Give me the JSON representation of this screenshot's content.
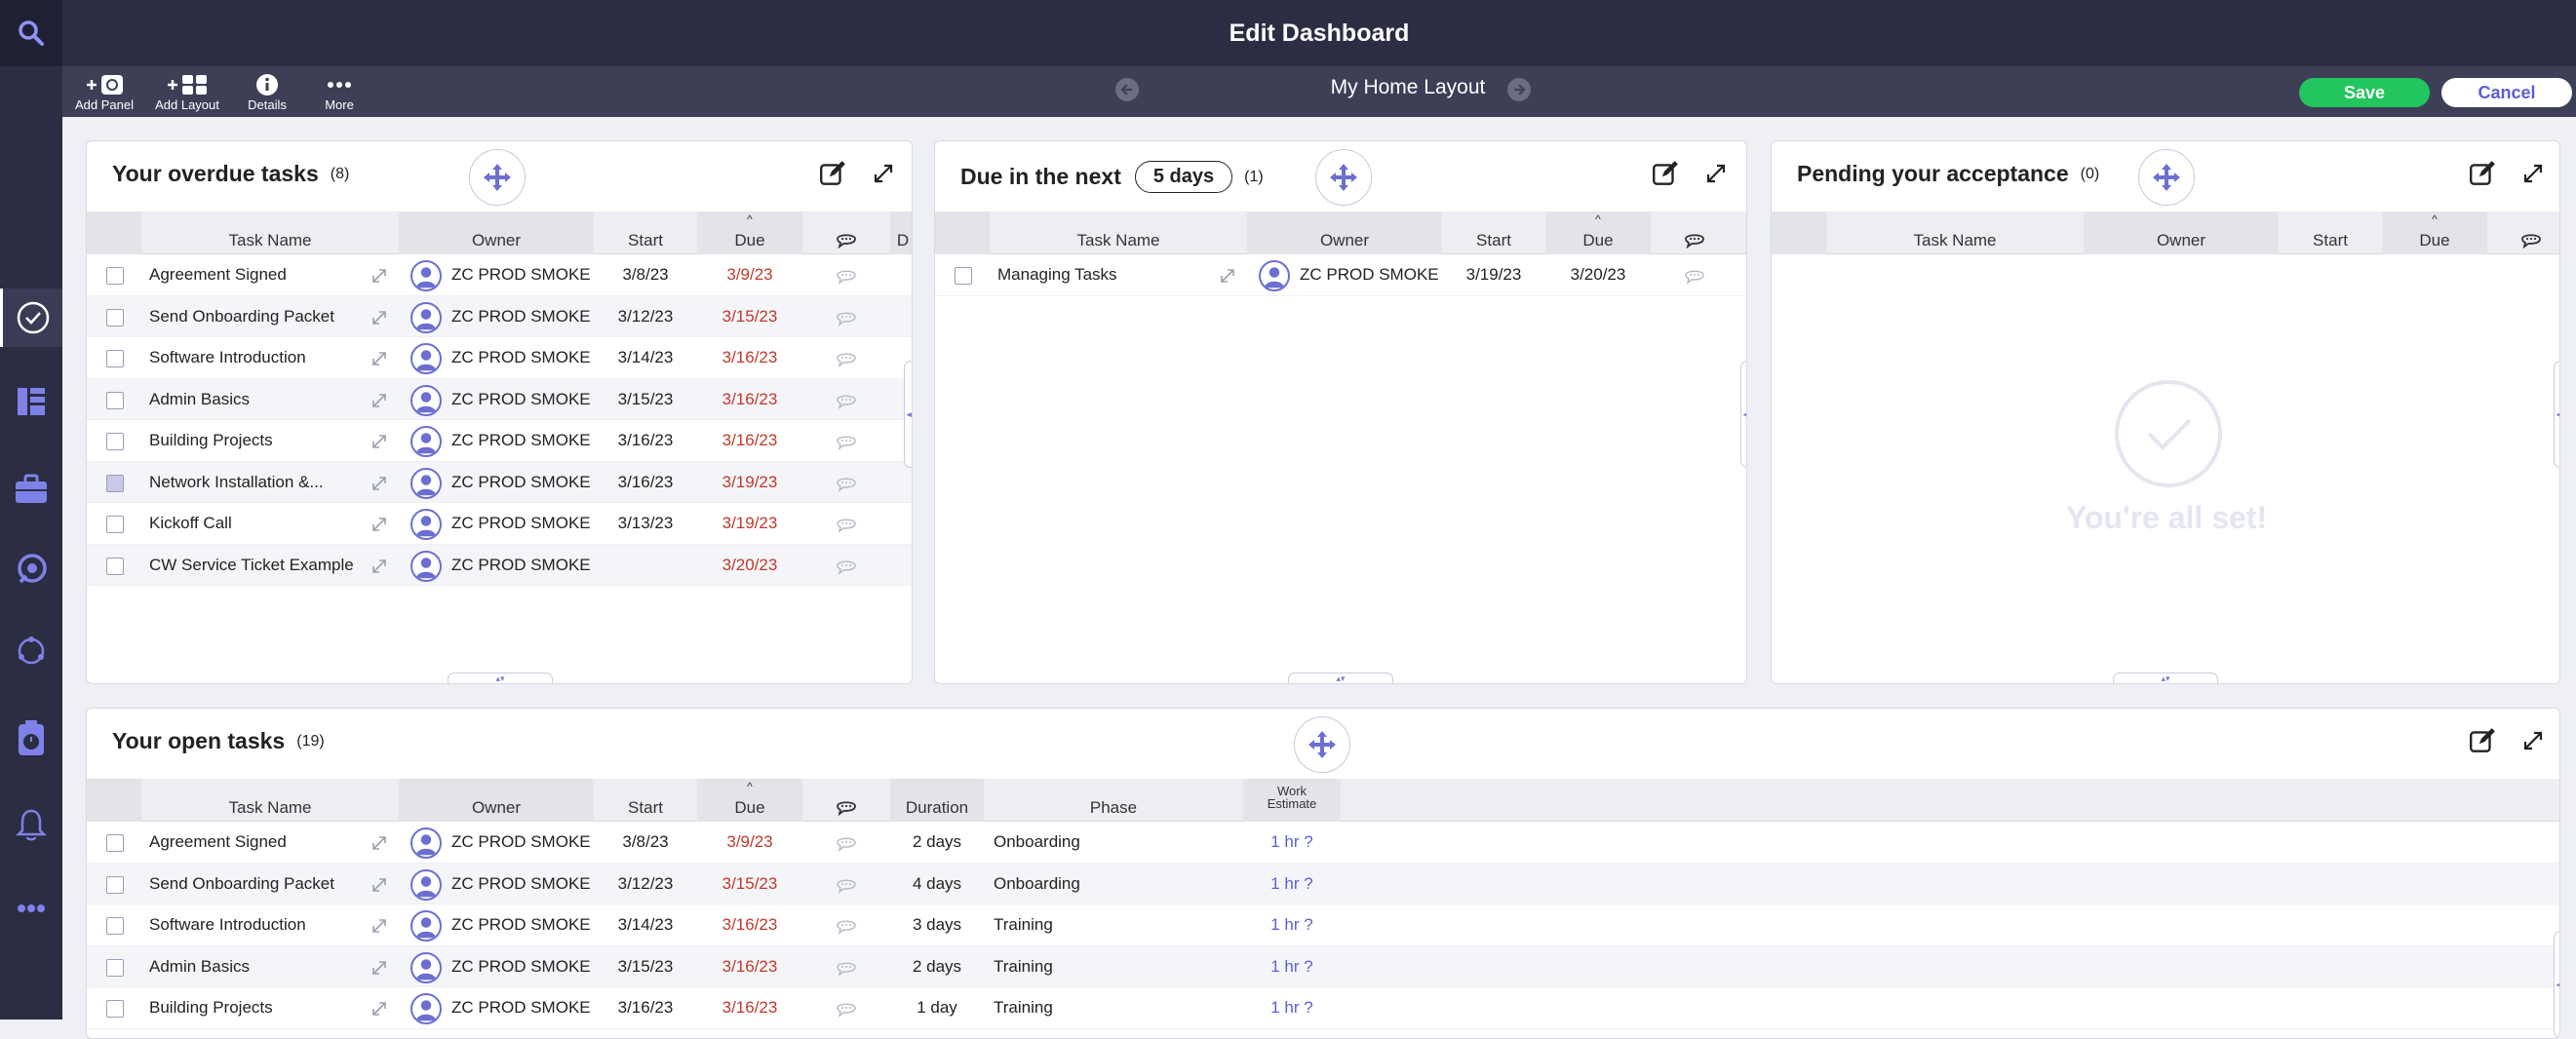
{
  "title": "Edit Dashboard",
  "toolbar": {
    "add_panel": "Add Panel",
    "add_layout": "Add Layout",
    "details": "Details",
    "more": "More",
    "layout_name": "My Home Layout",
    "save": "Save",
    "cancel": "Cancel"
  },
  "colors": {
    "sidebar": "#2b2d42",
    "toolbar": "#3d3f57",
    "save": "#22c55e",
    "accent": "#5b5fd6",
    "due": "#c0392b"
  },
  "panels": {
    "overdue": {
      "title": "Your overdue tasks",
      "count": "(8)",
      "headers": {
        "task": "Task Name",
        "owner": "Owner",
        "start": "Start",
        "due": "Due",
        "extra": "D"
      },
      "rows": [
        {
          "name": "Agreement Signed",
          "owner": "ZC PROD SMOKE",
          "start": "3/8/23",
          "due": "3/9/23"
        },
        {
          "name": "Send Onboarding Packet",
          "owner": "ZC PROD SMOKE",
          "start": "3/12/23",
          "due": "3/15/23"
        },
        {
          "name": "Software Introduction",
          "owner": "ZC PROD SMOKE",
          "start": "3/14/23",
          "due": "3/16/23"
        },
        {
          "name": "Admin Basics",
          "owner": "ZC PROD SMOKE",
          "start": "3/15/23",
          "due": "3/16/23"
        },
        {
          "name": "Building Projects",
          "owner": "ZC PROD SMOKE",
          "start": "3/16/23",
          "due": "3/16/23"
        },
        {
          "name": "Network Installation &...",
          "owner": "ZC PROD SMOKE",
          "start": "3/16/23",
          "due": "3/19/23"
        },
        {
          "name": "Kickoff Call",
          "owner": "ZC PROD SMOKE",
          "start": "3/13/23",
          "due": "3/19/23"
        },
        {
          "name": "CW Service Ticket Example",
          "owner": "ZC PROD SMOKE",
          "start": "",
          "due": "3/20/23"
        }
      ]
    },
    "duenext": {
      "title": "Due in the next",
      "days": "5 days",
      "count": "(1)",
      "headers": {
        "task": "Task Name",
        "owner": "Owner",
        "start": "Start",
        "due": "Due"
      },
      "rows": [
        {
          "name": "Managing Tasks",
          "owner": "ZC PROD SMOKE",
          "start": "3/19/23",
          "due": "3/20/23"
        }
      ]
    },
    "pending": {
      "title": "Pending your acceptance",
      "count": "(0)",
      "headers": {
        "task": "Task Name",
        "owner": "Owner",
        "start": "Start",
        "due": "Due"
      },
      "empty": "You're all set!"
    },
    "open": {
      "title": "Your open tasks",
      "count": "(19)",
      "headers": {
        "task": "Task Name",
        "owner": "Owner",
        "start": "Start",
        "due": "Due",
        "duration": "Duration",
        "phase": "Phase",
        "work1": "Work",
        "work2": "Estimate"
      },
      "rows": [
        {
          "name": "Agreement Signed",
          "owner": "ZC PROD SMOKE",
          "start": "3/8/23",
          "due": "3/9/23",
          "duration": "2 days",
          "phase": "Onboarding",
          "work": "1 hr ?"
        },
        {
          "name": "Send Onboarding Packet",
          "owner": "ZC PROD SMOKE",
          "start": "3/12/23",
          "due": "3/15/23",
          "duration": "4 days",
          "phase": "Onboarding",
          "work": "1 hr ?"
        },
        {
          "name": "Software Introduction",
          "owner": "ZC PROD SMOKE",
          "start": "3/14/23",
          "due": "3/16/23",
          "duration": "3 days",
          "phase": "Training",
          "work": "1 hr ?"
        },
        {
          "name": "Admin Basics",
          "owner": "ZC PROD SMOKE",
          "start": "3/15/23",
          "due": "3/16/23",
          "duration": "2 days",
          "phase": "Training",
          "work": "1 hr ?"
        },
        {
          "name": "Building Projects",
          "owner": "ZC PROD SMOKE",
          "start": "3/16/23",
          "due": "3/16/23",
          "duration": "1 day",
          "phase": "Training",
          "work": "1 hr ?"
        }
      ]
    }
  }
}
